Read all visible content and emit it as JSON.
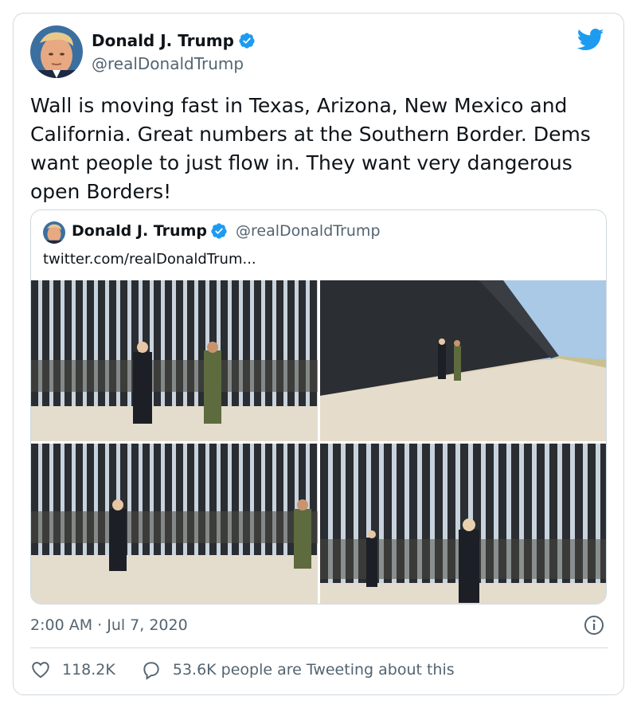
{
  "author": {
    "name": "Donald J. Trump",
    "handle": "@realDonaldTrump"
  },
  "tweet": {
    "text": "Wall is moving fast in Texas, Arizona, New Mexico and California. Great numbers at the Southern Border. Dems want people to just flow in. They want very dangerous open Borders!"
  },
  "quoted_tweet": {
    "name": "Donald J. Trump",
    "handle": "@realDonaldTrump",
    "link_text": "twitter.com/realDonaldTrum..."
  },
  "footer": {
    "timestamp": "2:00 AM · Jul 7, 2020",
    "likes": "118.2K",
    "tweeting": "53.6K people are Tweeting about this"
  },
  "colors": {
    "twitter_blue": "#1d9bf0",
    "secondary_text": "#536471",
    "border": "#cfd9de"
  },
  "icons": [
    "verified-badge-icon",
    "twitter-bird-icon",
    "info-icon",
    "heart-icon",
    "speech-bubble-icon"
  ]
}
